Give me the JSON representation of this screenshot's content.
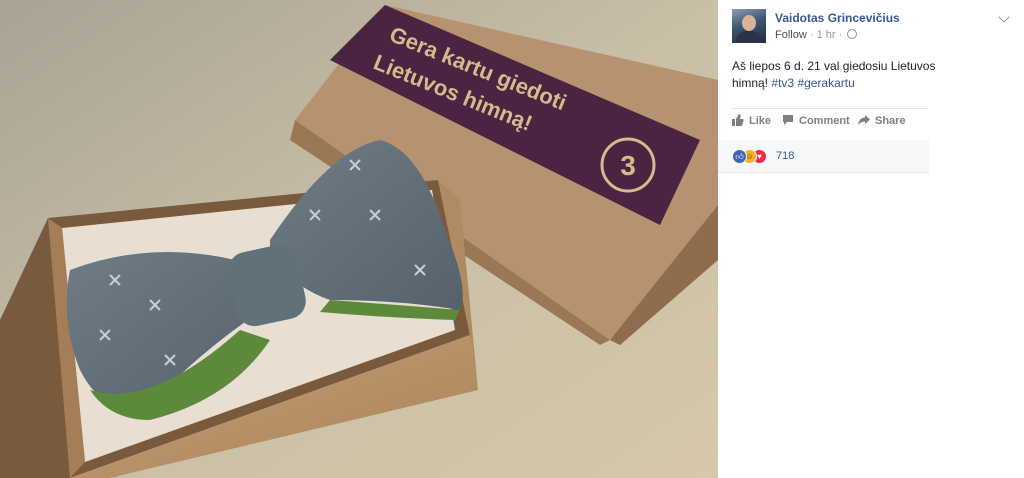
{
  "photo": {
    "box_text_line1": "Gera kartu giedoti",
    "box_text_line2": "Lietuvos himną!",
    "logo_char": "3"
  },
  "post": {
    "author": "Vaidotas Grincevičius",
    "follow_label": "Follow",
    "time": "1 hr",
    "text_main": "Aš liepos 6 d. 21 val giedosiu Lietuvos himną! ",
    "tag1": "#tv3",
    "tag2": "#gerakartu"
  },
  "actions": {
    "like": "Like",
    "comment": "Comment",
    "share": "Share"
  },
  "reactions": {
    "count": "718",
    "types": [
      "like-icon",
      "haha-icon",
      "love-icon"
    ]
  },
  "colors": {
    "link": "#365899",
    "like_blue": "#4267b2",
    "haha_yellow": "#f7b125",
    "love_red": "#f0284a",
    "box_band": "#4a2440"
  }
}
